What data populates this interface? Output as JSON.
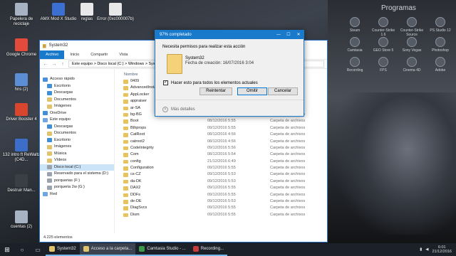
{
  "desktop": {
    "icons": [
      {
        "label": "Papelera de reciclaje",
        "color": "#a7b3c2"
      },
      {
        "label": "AMX Mod X Studio",
        "color": "#3b6fd1"
      },
      {
        "label": "reglas",
        "color": "#e8e8e8"
      },
      {
        "label": "Error (0xc000007b)",
        "color": "#e8e8e8"
      },
      {
        "label": "Google Chrome",
        "color": "#e24b3b"
      },
      {
        "label": "hns (2)",
        "color": "#5c8ed6"
      },
      {
        "label": "Driver Booster 4",
        "color": "#d9462d"
      },
      {
        "label": "132 intro ft ReWaltz (C4D...",
        "color": "#3c6ec9"
      },
      {
        "label": "Destruir Man...",
        "color": "#3a3f46"
      },
      {
        "label": "cuentas (2)",
        "color": "#a7b3c2"
      }
    ],
    "programs_title": "Programas",
    "programs": [
      "Steam",
      "Counter-Strike 1.6",
      "Counter-Strike Source",
      "PS Studio 12",
      "Camtasia",
      "GEO Store 5",
      "Sony Vegas",
      "Photoshop",
      "Recording",
      "FPS",
      "Cinema 4D",
      "Adobe"
    ]
  },
  "explorer": {
    "title": "System32",
    "ribbon_tabs": [
      "Archivo",
      "Inicio",
      "Compartir",
      "Vista"
    ],
    "path": "Este equipo  >  Disco local (C:)  >  Windows  >  System32",
    "nav": [
      {
        "label": "Acceso rápido",
        "color": "#4a8fdc"
      },
      {
        "label": "Escritorio",
        "color": "#3f8ed8"
      },
      {
        "label": "Descargas",
        "color": "#3f8ed8"
      },
      {
        "label": "Documentos",
        "color": "#e0c36c"
      },
      {
        "label": "Imágenes",
        "color": "#e0c36c"
      },
      {
        "label": "OneDrive",
        "color": "#3f8ed8"
      },
      {
        "label": "Este equipo",
        "color": "#6da6e3"
      },
      {
        "label": "Descargas",
        "color": "#3f8ed8"
      },
      {
        "label": "Documentos",
        "color": "#e0c36c"
      },
      {
        "label": "Escritorio",
        "color": "#3f8ed8"
      },
      {
        "label": "Imágenes",
        "color": "#e0c36c"
      },
      {
        "label": "Música",
        "color": "#e0c36c"
      },
      {
        "label": "Vídeos",
        "color": "#e0c36c"
      },
      {
        "label": "Disco local (C:)",
        "color": "#9aa3ad"
      },
      {
        "label": "Reservado para el sistema (D:)",
        "color": "#9aa3ad"
      },
      {
        "label": "porquerias (F:)",
        "color": "#9aa3ad"
      },
      {
        "label": "porqueria 2w (G:)",
        "color": "#9aa3ad"
      },
      {
        "label": "Red",
        "color": "#6da6e3"
      }
    ],
    "column_header": "Nombre",
    "rows": [
      {
        "name": "0409",
        "date": "",
        "type": ""
      },
      {
        "name": "AdvancedInstallers",
        "date": "",
        "type": ""
      },
      {
        "name": "AppLocker",
        "date": "",
        "type": ""
      },
      {
        "name": "appraiser",
        "date": "",
        "type": ""
      },
      {
        "name": "ar-SA",
        "date": "",
        "type": ""
      },
      {
        "name": "bg-BG",
        "date": "09/12/2016 5:54",
        "type": "Carpeta de archivos"
      },
      {
        "name": "Boot",
        "date": "08/12/2016 5:55",
        "type": "Carpeta de archivos"
      },
      {
        "name": "Bthprops",
        "date": "09/12/2016 5:55",
        "type": "Carpeta de archivos"
      },
      {
        "name": "CatRoot",
        "date": "08/12/2016 4:56",
        "type": "Carpeta de archivos"
      },
      {
        "name": "catroot2",
        "date": "08/12/2016 4:56",
        "type": "Carpeta de archivos"
      },
      {
        "name": "CodeIntegrity",
        "date": "09/12/2016 5:56",
        "type": "Carpeta de archivos"
      },
      {
        "name": "Com",
        "date": "08/12/2016 5:54",
        "type": "Carpeta de archivos"
      },
      {
        "name": "config",
        "date": "21/12/2016 6:49",
        "type": "Carpeta de archivos"
      },
      {
        "name": "Configuration",
        "date": "09/12/2016 5:55",
        "type": "Carpeta de archivos"
      },
      {
        "name": "cs-CZ",
        "date": "09/12/2016 5:53",
        "type": "Carpeta de archivos"
      },
      {
        "name": "da-DK",
        "date": "09/12/2016 5:53",
        "type": "Carpeta de archivos"
      },
      {
        "name": "DAX2",
        "date": "09/12/2016 5:55",
        "type": "Carpeta de archivos"
      },
      {
        "name": "DDFs",
        "date": "09/12/2016 5:55",
        "type": "Carpeta de archivos"
      },
      {
        "name": "de-DE",
        "date": "09/12/2016 5:53",
        "type": "Carpeta de archivos"
      },
      {
        "name": "DiagSvcs",
        "date": "09/12/2016 5:55",
        "type": "Carpeta de archivos"
      },
      {
        "name": "Dism",
        "date": "09/12/2016 5:55",
        "type": "Carpeta de archivos"
      }
    ],
    "status": "4.225 elementos"
  },
  "dialog": {
    "title": "97% completado",
    "message": "Necesita permisos para realizar esta acción",
    "file_name": "System32",
    "file_date": "Fecha de creación: 16/07/2016 3:04",
    "checkbox_label": "Hacer esto para todos los elementos actuales",
    "checkbox_mark": "✓",
    "btn_retry": "Reintentar",
    "btn_skip": "Omitir",
    "btn_cancel": "Cancelar",
    "more_details": "Más detalles"
  },
  "taskbar": {
    "apps": [
      {
        "label": "System32",
        "color": "#e0c36c",
        "active": false
      },
      {
        "label": "Acceso a la carpeta...",
        "color": "#e0c36c",
        "active": true
      },
      {
        "label": "Camtasia Studio - ...",
        "color": "#3a9a4a",
        "active": false
      },
      {
        "label": "Recording...",
        "color": "#c73b3b",
        "active": false
      }
    ],
    "time": "6:01",
    "date": "21/12/2016"
  }
}
